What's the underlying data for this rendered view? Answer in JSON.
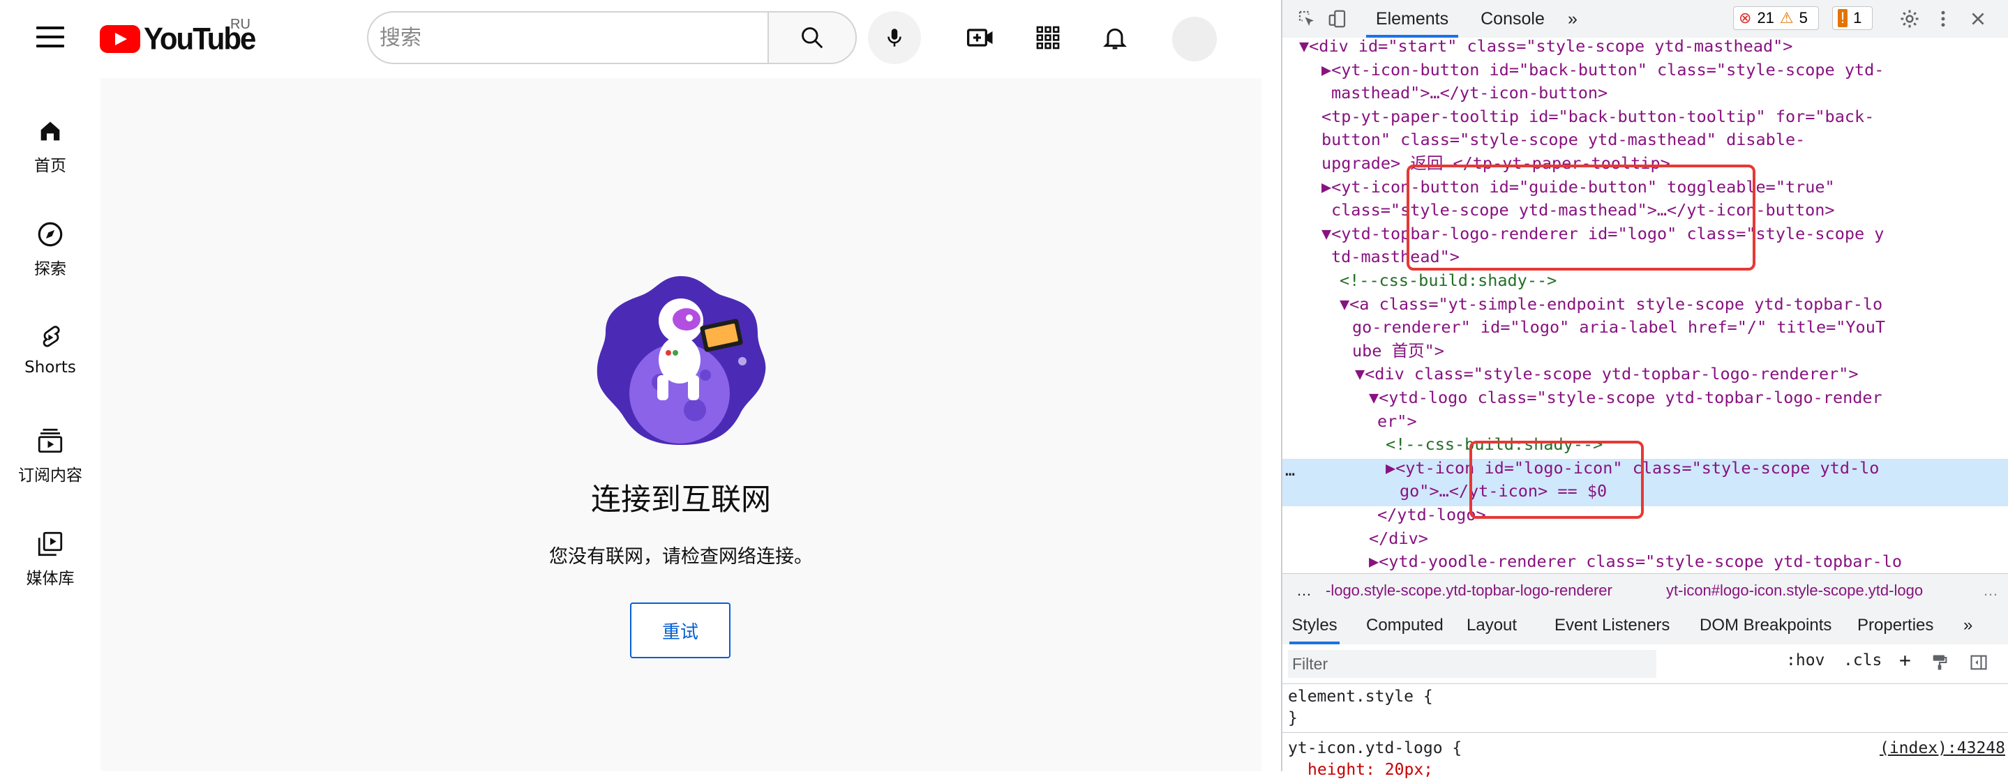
{
  "youtube": {
    "logo_text": "YouTube",
    "logo_region": "RU",
    "search": {
      "placeholder": "搜索"
    },
    "guide": [
      {
        "label": "首页",
        "icon": "home-icon"
      },
      {
        "label": "探索",
        "icon": "compass-icon"
      },
      {
        "label": "Shorts",
        "icon": "shorts-icon"
      },
      {
        "label": "订阅内容",
        "icon": "subscriptions-icon"
      },
      {
        "label": "媒体库",
        "icon": "library-icon"
      }
    ],
    "offline": {
      "title": "连接到互联网",
      "description": "您没有联网，请检查网络连接。",
      "retry_label": "重试"
    },
    "colors": {
      "brand_red": "#ff0000",
      "link_blue": "#065fd4",
      "content_bg": "#f9f9f9"
    }
  },
  "devtools": {
    "tabs": [
      "Elements",
      "Console",
      "»"
    ],
    "badges": {
      "errors": "21",
      "warnings": "5",
      "issues": "1"
    },
    "dom_lines": [
      {
        "text": "▼<div id=\"start\" class=\"style-scope ytd-masthead\">"
      },
      {
        "text": "▶<yt-icon-button id=\"back-button\" class=\"style-scope ytd-"
      },
      {
        "text": "masthead\">…</yt-icon-button>"
      },
      {
        "text": "<tp-yt-paper-tooltip id=\"back-button-tooltip\" for=\"back-"
      },
      {
        "text": "button\" class=\"style-scope ytd-masthead\" disable-"
      },
      {
        "text": "upgrade> 返回 </tp-yt-paper-tooltip>"
      },
      {
        "text": "▶<yt-icon-button id=\"guide-button\" toggleable=\"true\""
      },
      {
        "text": "class=\"style-scope ytd-masthead\">…</yt-icon-button>"
      },
      {
        "text": "▼<ytd-topbar-logo-renderer id=\"logo\" class=\"style-scope y"
      },
      {
        "text": "td-masthead\">"
      },
      {
        "text": "<!--css-build:shady-->"
      },
      {
        "text": "▼<a class=\"yt-simple-endpoint style-scope ytd-topbar-lo"
      },
      {
        "text": "go-renderer\" id=\"logo\" aria-label href=\"/\" title=\"YouT"
      },
      {
        "text": "ube 首页\">"
      },
      {
        "text": "▼<div class=\"style-scope ytd-topbar-logo-renderer\">"
      },
      {
        "text": "▼<ytd-logo class=\"style-scope ytd-topbar-logo-render"
      },
      {
        "text": "er\">"
      },
      {
        "text": "<!--css-build:shady-->"
      },
      {
        "text": "▶<yt-icon id=\"logo-icon\" class=\"style-scope ytd-lo"
      },
      {
        "text": "go\">…</yt-icon> == $0"
      },
      {
        "text": "</ytd-logo>"
      },
      {
        "text": "</div>"
      },
      {
        "text": "▶<ytd-yoodle-renderer class=\"style-scope ytd-topbar-lo"
      }
    ],
    "selected_marker": "…",
    "breadcrumbs": {
      "more_left": "…",
      "item1": "-logo.style-scope.ytd-topbar-logo-renderer",
      "item2": "yt-icon#logo-icon.style-scope.ytd-logo",
      "more_right": "…"
    },
    "sub_tabs": [
      "Styles",
      "Computed",
      "Layout",
      "Event Listeners",
      "DOM Breakpoints",
      "Properties",
      "»"
    ],
    "filter": {
      "placeholder": "Filter",
      "hov": ":hov",
      "cls": ".cls",
      "add": "+"
    },
    "rules": {
      "element_style": "element.style {",
      "close": "}",
      "selector": "yt-icon.ytd-logo {",
      "source": "(index):43248",
      "prop": "height: 20px;"
    },
    "colors": {
      "highlight_box": "#e53935",
      "selected_row": "#cfe8fc",
      "accent": "#1a73e8"
    }
  }
}
